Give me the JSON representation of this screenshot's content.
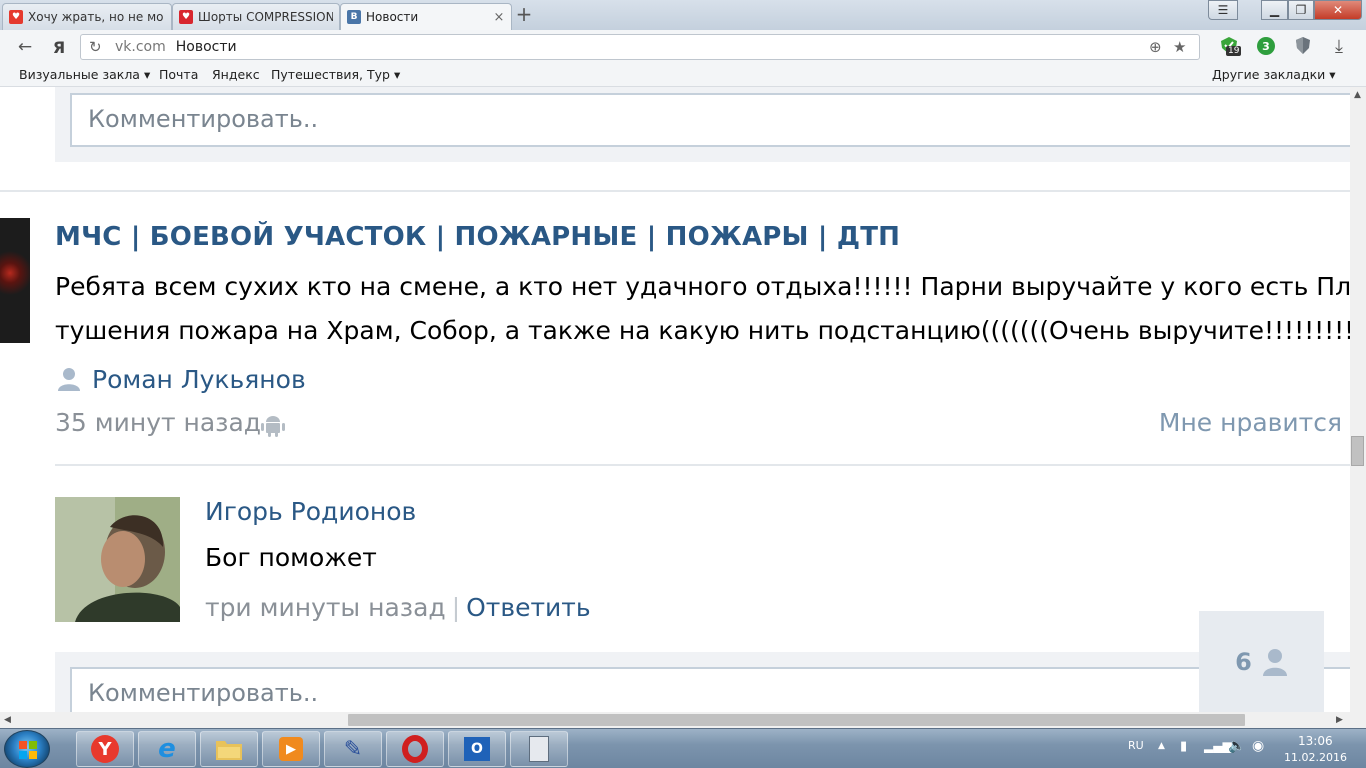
{
  "browser": {
    "tabs": [
      {
        "title": "Хочу жрать, но не мо",
        "favicon_color": "#e53a2e",
        "active": false
      },
      {
        "title": "Шорты COMPRESSION",
        "favicon_color": "#d8262e",
        "active": false
      },
      {
        "title": "Новости",
        "favicon_color": "#4a76a8",
        "favicon_glyph": "B",
        "active": true
      }
    ],
    "new_tab_glyph": "+",
    "address": {
      "domain": "vk.com",
      "page_title": "Новости"
    },
    "extensions": {
      "adblock_badge": "19",
      "green_badge": "3"
    },
    "bookmarks": [
      {
        "label": "Визуальные закла",
        "dropdown": true
      },
      {
        "label": "Почта",
        "dropdown": false
      },
      {
        "label": "Яндекс",
        "dropdown": false
      },
      {
        "label": "Путешествия, Тур",
        "dropdown": true
      }
    ],
    "other_bookmarks": "Другие закладки"
  },
  "page": {
    "top_comment_placeholder": "Комментировать..",
    "post": {
      "group_name": "МЧС | БОЕВОЙ УЧАСТОК | ПОЖАРНЫЕ | ПОЖАРЫ | ДТП",
      "text_line1": "Ребята всем сухих кто на смене, а кто нет удачного отдыха!!!!!! Парни выручайте у кого есть План",
      "text_line2": "тушения пожара на Храм, Собор, а также на какую нить подстанцию(((((((Очень выручите!!!!!!!!!!!!!!!",
      "author": "Роман Лукьянов",
      "time": "35 минут назад",
      "like_label": "Мне нравится"
    },
    "comment": {
      "author": "Игорь Родионов",
      "text": "Бог поможет",
      "time": "три минуты назад",
      "separator": "|",
      "reply_label": "Ответить"
    },
    "bottom_comment_placeholder": "Комментировать..",
    "online_widget": {
      "count": "6"
    }
  },
  "taskbar": {
    "language": "RU",
    "time": "13:06",
    "date": "11.02.2016"
  },
  "colors": {
    "vk_link": "#2a5885",
    "vk_muted": "#8a9097",
    "vk_light_link": "#7f98b0"
  }
}
